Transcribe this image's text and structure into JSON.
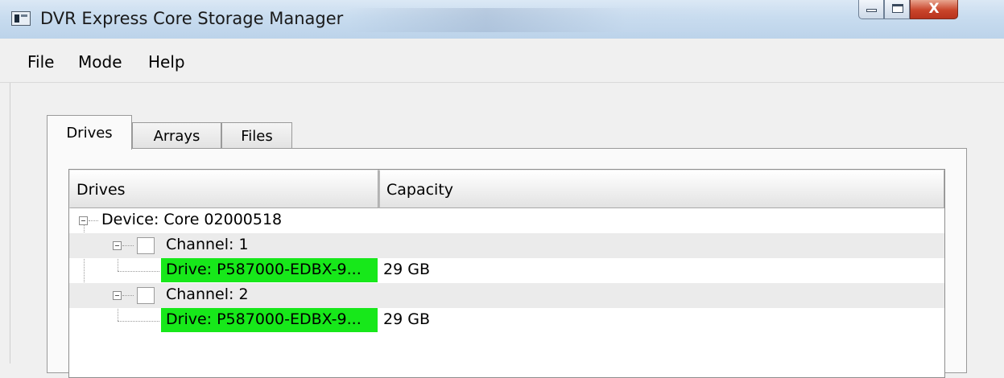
{
  "window": {
    "title": "DVR Express Core Storage Manager",
    "icon": "app-window-icon",
    "controls": {
      "minimize_icon": "minimize-icon",
      "maximize_icon": "maximize-icon",
      "close_glyph": "X"
    }
  },
  "menu": {
    "file": "File",
    "mode": "Mode",
    "help": "Help"
  },
  "tabs": [
    {
      "label": "Drives",
      "selected": true
    },
    {
      "label": "Arrays",
      "selected": false
    },
    {
      "label": "Files",
      "selected": false
    }
  ],
  "tree": {
    "columns": [
      "Drives",
      "Capacity"
    ],
    "device": "Device: Core 02000518",
    "channels": [
      {
        "label": "Channel: 1",
        "drive": {
          "label": "Drive: P587000-EDBX-9...",
          "capacity": "29 GB"
        }
      },
      {
        "label": "Channel: 2",
        "drive": {
          "label": "Drive: P587000-EDBX-9...",
          "capacity": "29 GB"
        }
      }
    ],
    "highlight_color": "#17e81a"
  }
}
